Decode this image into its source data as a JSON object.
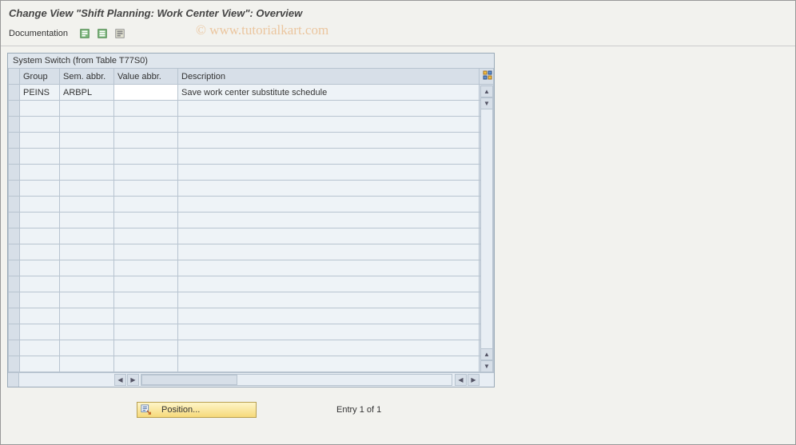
{
  "title": "Change View \"Shift Planning: Work Center View\": Overview",
  "toolbar": {
    "documentation": "Documentation"
  },
  "panel": {
    "header": "System Switch (from Table T77S0)"
  },
  "table": {
    "columns": {
      "group": "Group",
      "sem_abbr": "Sem. abbr.",
      "value_abbr": "Value abbr.",
      "description": "Description"
    },
    "rows": [
      {
        "group": "PEINS",
        "sem_abbr": "ARBPL",
        "value_abbr": "",
        "description": "Save work center substitute schedule"
      }
    ],
    "empty_rows": 17
  },
  "footer": {
    "position_label": "Position...",
    "entry_text": "Entry 1 of 1"
  },
  "watermark": "© www.tutorialkart.com"
}
